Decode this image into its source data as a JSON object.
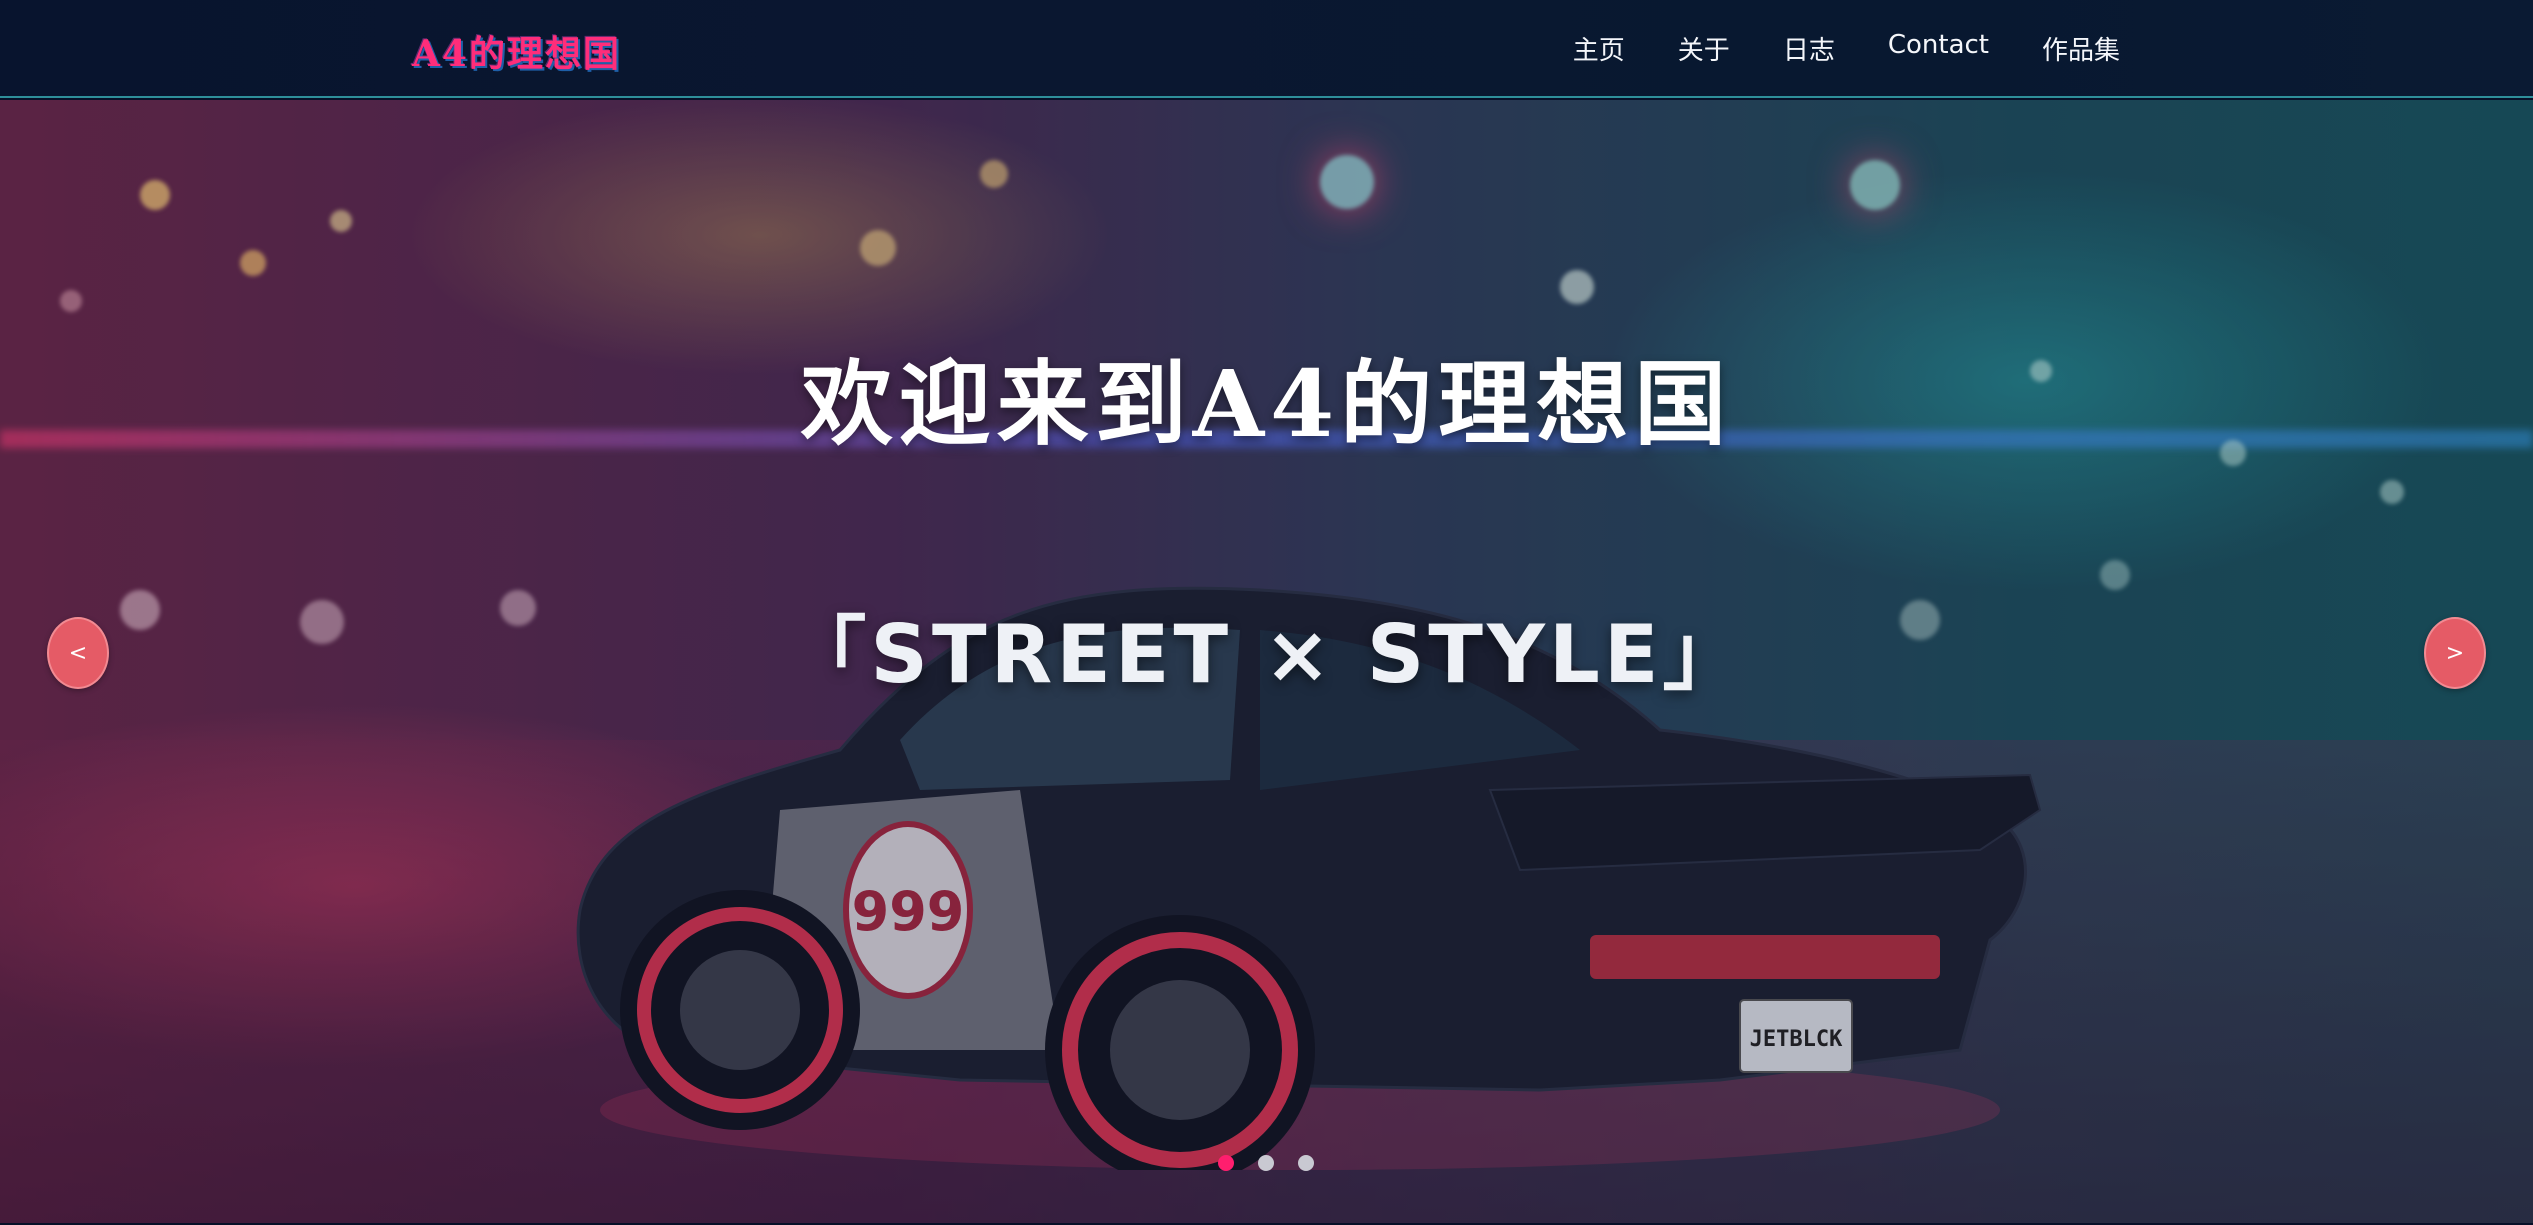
{
  "navbar": {
    "brand": "A4的理想国",
    "links": [
      "主页",
      "关于",
      "日志",
      "Contact",
      "作品集"
    ]
  },
  "hero": {
    "title": "欢迎来到A4的理想国",
    "subtitle": "「STREET × STYLE」",
    "prev_label": "<",
    "next_label": ">",
    "plate_text": "JETBLCK",
    "car_number": "999",
    "slide_count": 3,
    "active_slide": 1
  },
  "colors": {
    "nav_background": "#08142e",
    "nav_border": "#2e8f9a",
    "brand_accent": "#ff2d7a",
    "button_background": "#e55b66",
    "dot_active": "#ff1e6e",
    "dot_inactive": "#c9c9d2"
  },
  "icons": {
    "prev": "chevron-left-icon",
    "next": "chevron-right-icon"
  }
}
